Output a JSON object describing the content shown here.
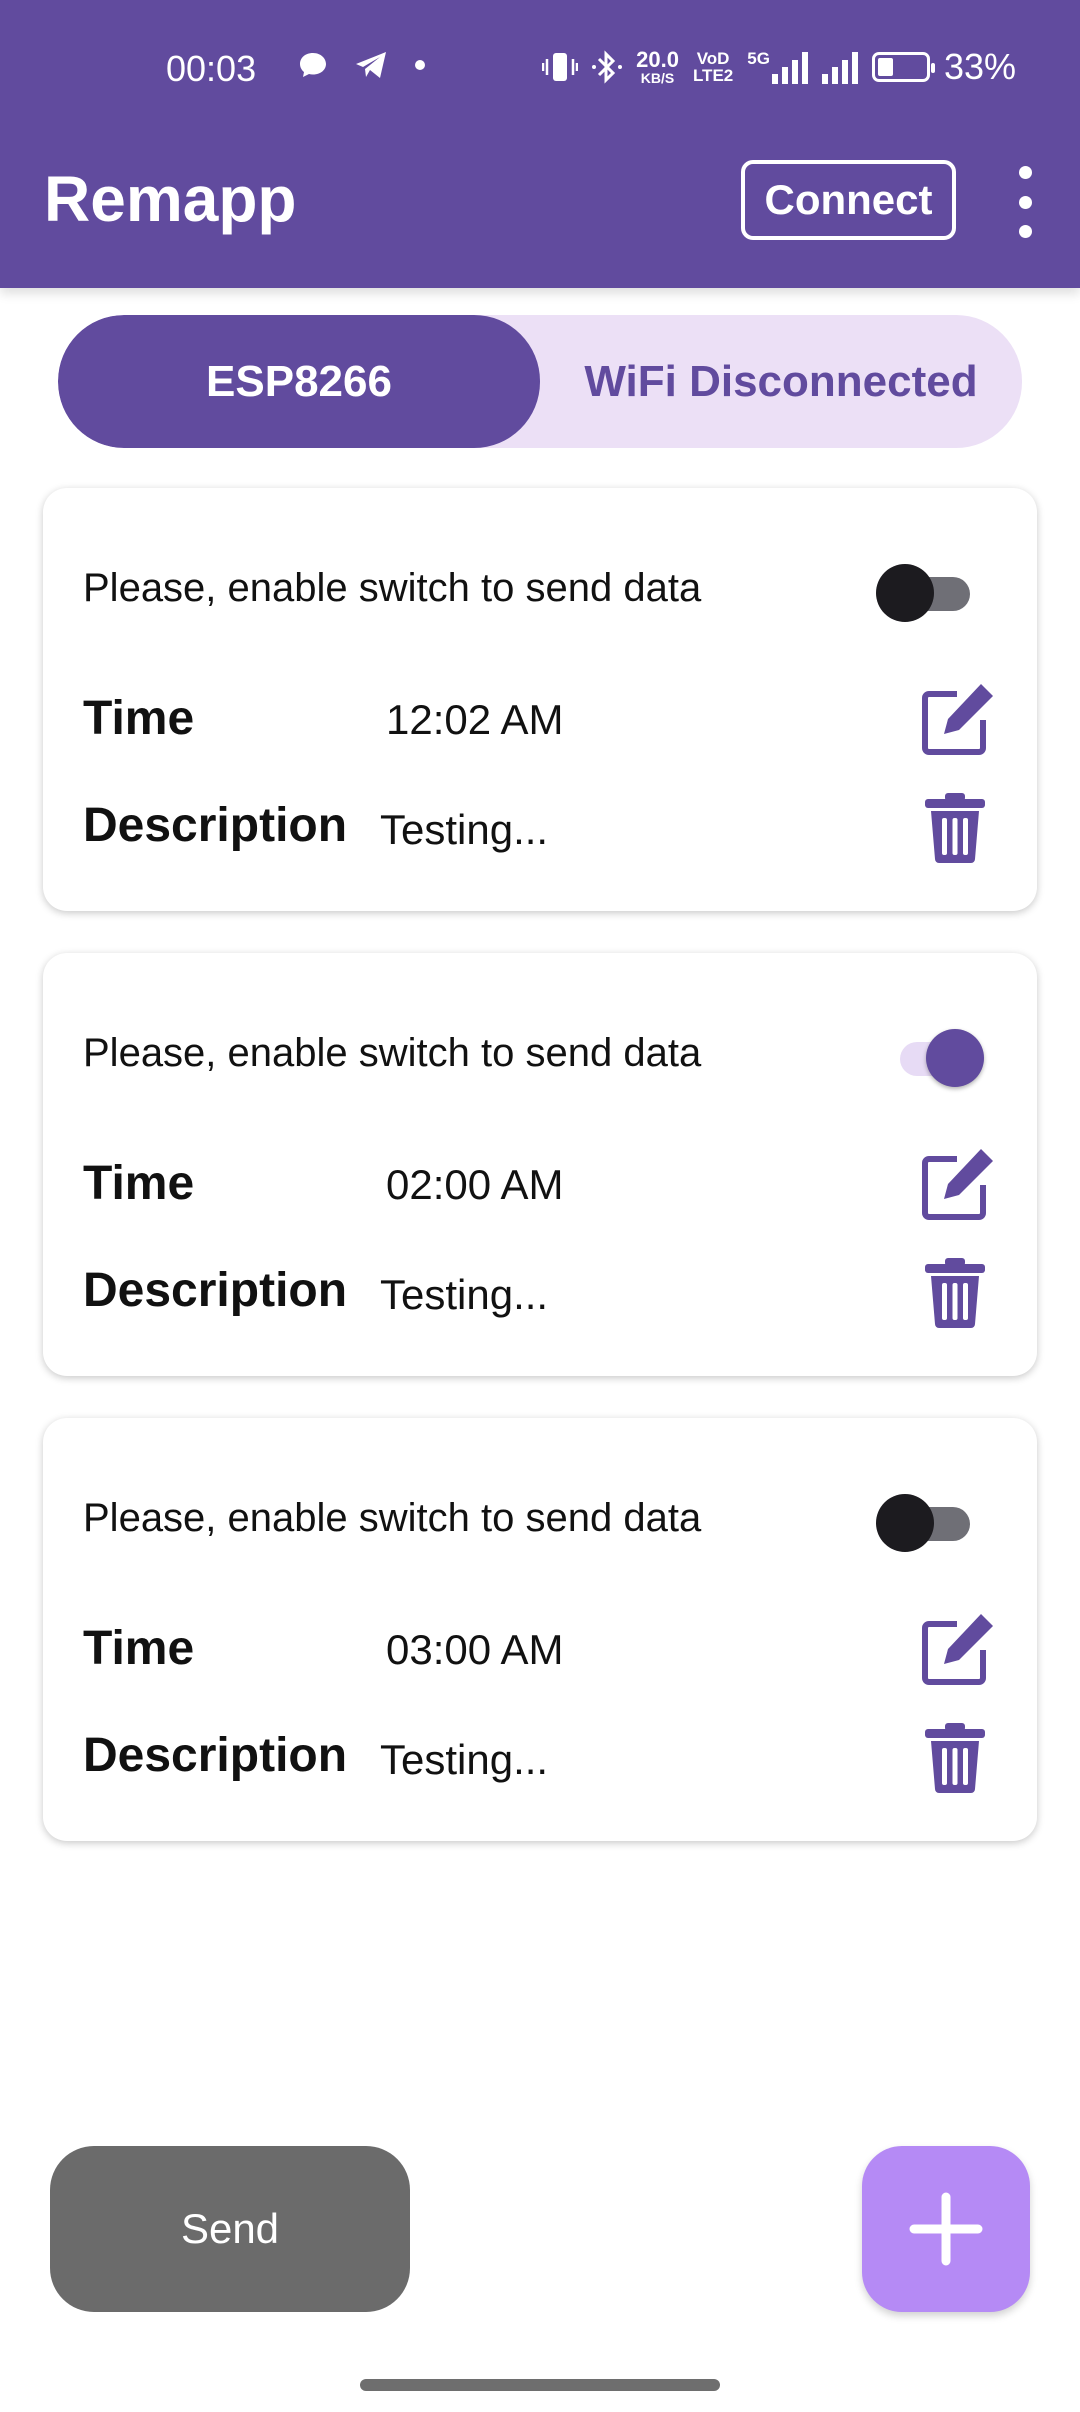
{
  "status_bar": {
    "time": "00:03",
    "net_speed_value": "20.0",
    "net_speed_unit": "KB/S",
    "volte_top": "VoD",
    "volte_bottom": "LTE2",
    "net_type": "5G",
    "battery": "33%",
    "battery_level": 0.33
  },
  "app_bar": {
    "title": "Remapp",
    "connect_label": "Connect"
  },
  "segment": {
    "device_label": "ESP8266",
    "wifi_label": "WiFi Disconnected"
  },
  "cards": [
    {
      "prompt": "Please, enable switch to send data",
      "enabled": false,
      "time_label": "Time",
      "time": "12:02 AM",
      "description_label": "Description",
      "description": "Testing..."
    },
    {
      "prompt": "Please, enable switch to send data",
      "enabled": true,
      "time_label": "Time",
      "time": "02:00 AM",
      "description_label": "Description",
      "description": "Testing..."
    },
    {
      "prompt": "Please, enable switch to send data",
      "enabled": false,
      "time_label": "Time",
      "time": "03:00 AM",
      "description_label": "Description",
      "description": "Testing..."
    }
  ],
  "send_label": "Send",
  "colors": {
    "primary": "#614b9e",
    "segment_bg": "#ece0f6",
    "fab": "#b58af5",
    "send_button": "#6b6b6b"
  },
  "icons": {
    "edit": "edit-icon",
    "delete": "trash-icon",
    "add": "plus-icon",
    "menu": "more-vert-icon"
  }
}
